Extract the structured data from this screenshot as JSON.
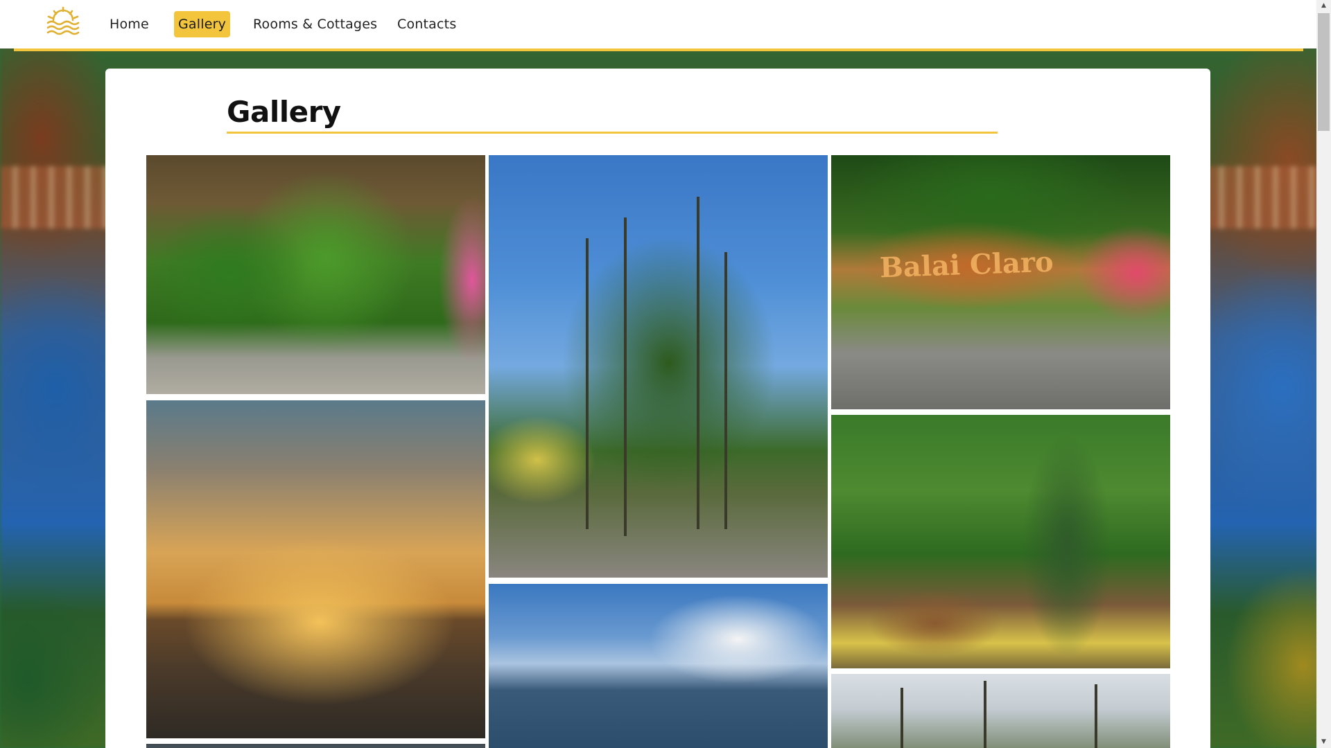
{
  "nav": {
    "logo": "sun-waves-logo",
    "items": [
      {
        "label": "Home",
        "active": false
      },
      {
        "label": "Gallery",
        "active": true
      },
      {
        "label": "Rooms & Cottages",
        "active": false
      },
      {
        "label": "Contacts",
        "active": false
      }
    ]
  },
  "page": {
    "title": "Gallery"
  },
  "gallery": {
    "photos": [
      {
        "name": "garden-entrance-photo"
      },
      {
        "name": "coconut-palms-photo"
      },
      {
        "name": "balai-sign-photo",
        "sign_text": "Balai Claro"
      },
      {
        "name": "ocean-sunset-photo"
      },
      {
        "name": "dinosaur-statue-photo"
      },
      {
        "name": "beach-hut-photo"
      },
      {
        "name": "beach-palms-photo"
      },
      {
        "name": "partial-photo"
      }
    ]
  },
  "colors": {
    "accent": "#f2c53d",
    "card": "#ffffff"
  },
  "icons": {
    "scroll_up": "triangle-up-icon",
    "scroll_down": "triangle-down-icon"
  }
}
